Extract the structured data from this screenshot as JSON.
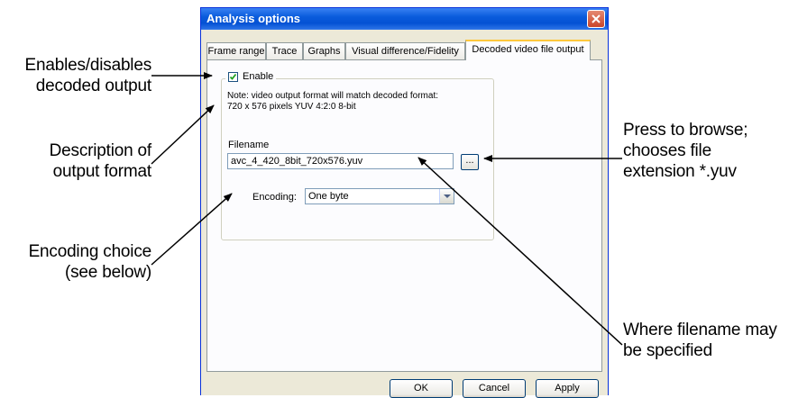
{
  "window": {
    "title": "Analysis options"
  },
  "tabs": [
    {
      "label": "Frame range",
      "active": false
    },
    {
      "label": "Trace",
      "active": false
    },
    {
      "label": "Graphs",
      "active": false
    },
    {
      "label": "Visual difference/Fidelity",
      "active": false
    },
    {
      "label": "Decoded video file output",
      "active": true
    }
  ],
  "output": {
    "enable_label": "Enable",
    "enable_checked": true,
    "note_line1": "Note: video output format will match decoded format:",
    "note_line2": "720 x 576 pixels YUV 4:2:0 8-bit",
    "filename_label": "Filename",
    "filename_value": "avc_4_420_8bit_720x576.yuv",
    "browse_label": "...",
    "encoding_label": "Encoding:",
    "encoding_value": "One byte"
  },
  "buttons": {
    "ok": "OK",
    "cancel": "Cancel",
    "apply": "Apply"
  },
  "callouts": {
    "enable_line1": "Enables/disables",
    "enable_line2": "decoded output",
    "description_line1": "Description of",
    "description_line2": "output format",
    "encoding_line1": "Encoding choice",
    "encoding_line2": "(see below)",
    "browse_line1": "Press to browse;",
    "browse_line2": "chooses file",
    "browse_line3": "extension *.yuv",
    "filename_line1": "Where filename may",
    "filename_line2": "be specified"
  },
  "colors": {
    "titlebar": "#0a5cdc",
    "dialog_bg": "#ece9d8",
    "panel_bg": "#fcfcfe",
    "active_tab_accent": "#ffc83c"
  }
}
